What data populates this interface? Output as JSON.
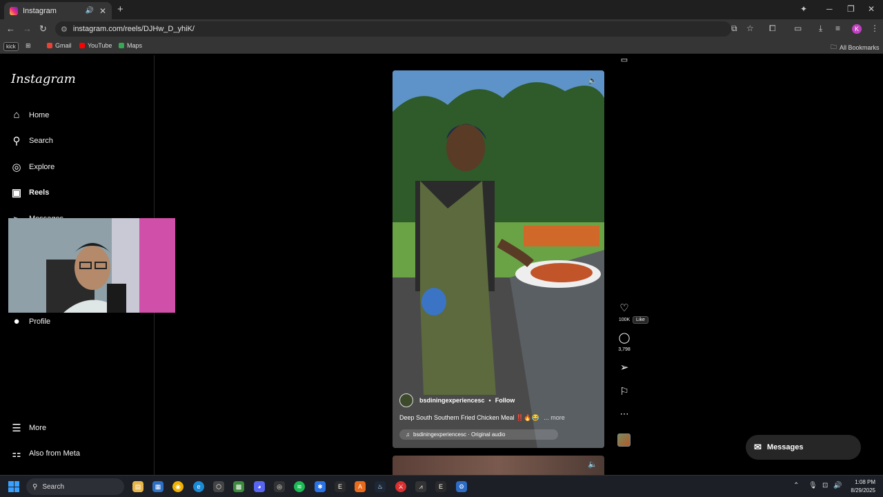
{
  "browser": {
    "tab_title": "Instagram",
    "new_tab": "+",
    "url": "instagram.com/reels/DJHw_D_yhiK/",
    "bookmarks": {
      "kick": "kick",
      "gmail": "Gmail",
      "youtube": "YouTube",
      "maps": "Maps",
      "all": "All Bookmarks"
    },
    "profile_initial": "K"
  },
  "sidebar": {
    "logo": "Instagram",
    "items": [
      {
        "label": "Home",
        "icon": "home-icon"
      },
      {
        "label": "Search",
        "icon": "search-icon"
      },
      {
        "label": "Explore",
        "icon": "compass-icon"
      },
      {
        "label": "Reels",
        "icon": "reels-icon"
      },
      {
        "label": "Messages",
        "icon": "messages-icon"
      },
      {
        "label": "Profile",
        "icon": "profile-icon"
      },
      {
        "label": "More",
        "icon": "menu-icon"
      },
      {
        "label": "Also from Meta",
        "icon": "meta-icon"
      }
    ]
  },
  "reel": {
    "author": "bsdiningexperiencesc",
    "follow": "Follow",
    "separator": "•",
    "caption": "Deep South Southern Fried Chicken Meal ‼️🔥😂",
    "more": "... more",
    "audio": "bsdiningexperiencesc · Original audio",
    "likes": "100K",
    "comments": "3,798",
    "like_tooltip": "Like"
  },
  "messages_button": "Messages",
  "taskbar": {
    "search": "Search",
    "time": "1:08 PM",
    "date": "8/29/2025"
  }
}
